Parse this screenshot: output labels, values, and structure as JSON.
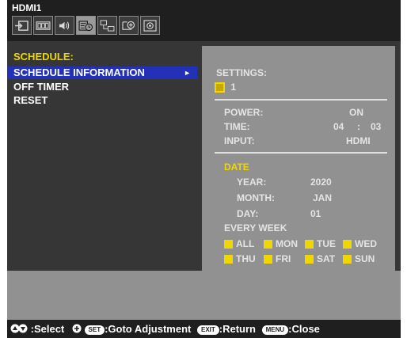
{
  "header": {
    "title": "HDMI1"
  },
  "iconbar": {
    "icons": [
      "input-icon",
      "picture-icon",
      "audio-icon",
      "schedule-icon",
      "network-icon",
      "protect-icon",
      "system-icon"
    ],
    "active_index": 3
  },
  "menu": {
    "title": "SCHEDULE:",
    "items": [
      "SCHEDULE INFORMATION",
      "OFF TIMER",
      "RESET"
    ],
    "selected_arrow": "►"
  },
  "detail": {
    "settings_label": "SETTINGS:",
    "settings_value": "1",
    "power_label": "POWER:",
    "power_value": "ON",
    "time_label": "TIME:",
    "time_hour": "04",
    "time_sep": ":",
    "time_min": "03",
    "input_label": "INPUT:",
    "input_value": "HDMI",
    "date_label": "DATE",
    "year_label": "YEAR:",
    "year_value": "2020",
    "month_label": "MONTH:",
    "month_value": "JAN",
    "day_label": "DAY:",
    "day_value": "01",
    "every_week_label": "EVERY WEEK",
    "weekdays_row1": [
      "ALL",
      "MON",
      "TUE",
      "WED"
    ],
    "weekdays_row2": [
      "THU",
      "FRI",
      "SAT",
      "SUN"
    ]
  },
  "help": {
    "select": ":Select",
    "set_key": "SET",
    "goto": ":Goto Adjustment",
    "exit_key": "EXIT",
    "return": ":Return",
    "menu_key": "MENU",
    "close": ":Close"
  },
  "colors": {
    "accent_yellow": "#f0d700",
    "selection_blue": "#2330b8"
  }
}
